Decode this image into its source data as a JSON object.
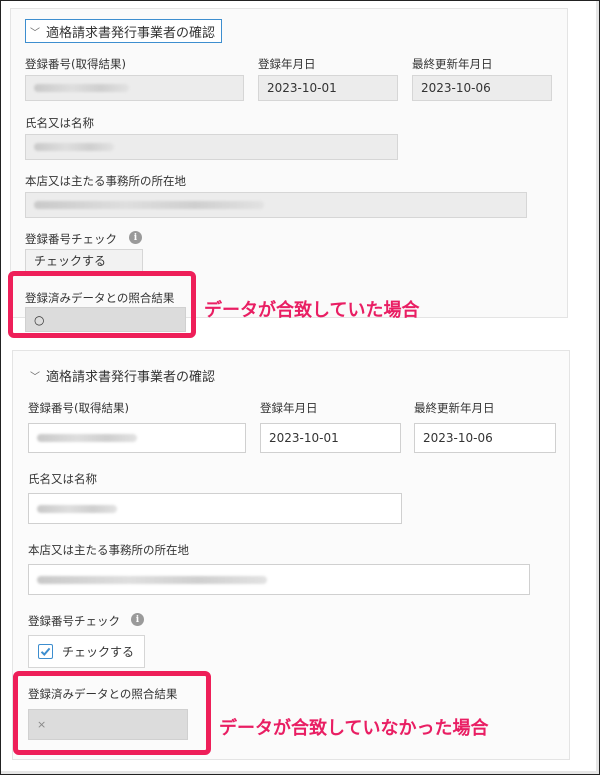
{
  "top": {
    "header": "適格請求書発行事業者の確認",
    "registration_number_label": "登録番号(取得結果)",
    "registration_date_label": "登録年月日",
    "last_updated_label": "最終更新年月日",
    "registration_date": "2023-10-01",
    "last_updated": "2023-10-06",
    "name_label": "氏名又は名称",
    "address_label": "本店又は主たる事務所の所在地",
    "check_label": "登録番号チェック",
    "check_button": "チェックする",
    "match_label": "登録済みデータとの照合結果",
    "match_value": "○",
    "annotation": "データが合致していた場合"
  },
  "bottom": {
    "header": "適格請求書発行事業者の確認",
    "registration_number_label": "登録番号(取得結果)",
    "registration_date_label": "登録年月日",
    "last_updated_label": "最終更新年月日",
    "registration_date": "2023-10-01",
    "last_updated": "2023-10-06",
    "name_label": "氏名又は名称",
    "address_label": "本店又は主たる事務所の所在地",
    "check_label": "登録番号チェック",
    "check_checkbox_label": "チェックする",
    "check_checked": true,
    "match_label": "登録済みデータとの照合結果",
    "match_value": "×",
    "annotation": "データが合致していなかった場合"
  },
  "colors": {
    "highlight": "#ee1f59",
    "annotation_text": "#e91e63",
    "accent": "#3d8ecf"
  },
  "icons": {
    "chevron": "chevron-down-icon",
    "info": "info-icon",
    "check": "checkmark-icon"
  }
}
